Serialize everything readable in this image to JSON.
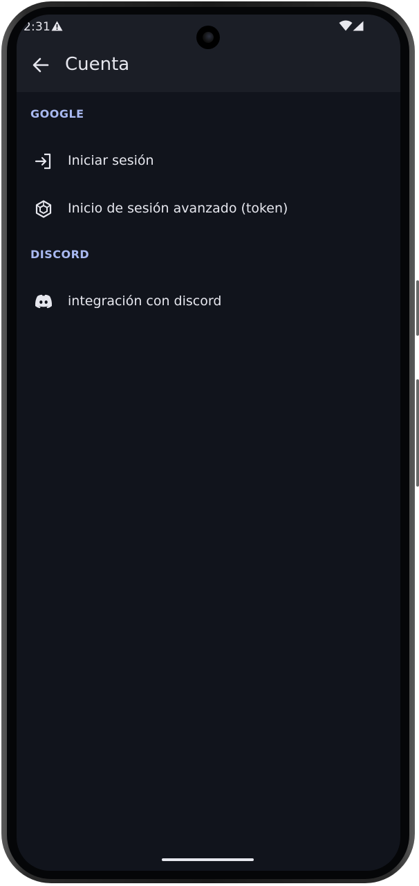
{
  "status_bar": {
    "time": "2:31",
    "alert_icon": "warning-triangle-icon",
    "wifi_icon": "wifi-icon",
    "signal_icon": "signal-icon"
  },
  "app_bar": {
    "back_icon": "arrow-left-icon",
    "title": "Cuenta"
  },
  "sections": [
    {
      "header": "GOOGLE",
      "items": [
        {
          "label": "Iniciar sesión",
          "icon": "login-icon"
        },
        {
          "label": "Inicio de sesión avanzado (token)",
          "icon": "cube-icon"
        }
      ]
    },
    {
      "header": "DISCORD",
      "items": [
        {
          "label": "integración con discord",
          "icon": "discord-icon"
        }
      ]
    }
  ],
  "colors": {
    "screen_background": "#11141c",
    "app_bar_background": "#1b1e26",
    "section_header": "#a9b9f1",
    "text_primary": "#e6e7ee"
  }
}
